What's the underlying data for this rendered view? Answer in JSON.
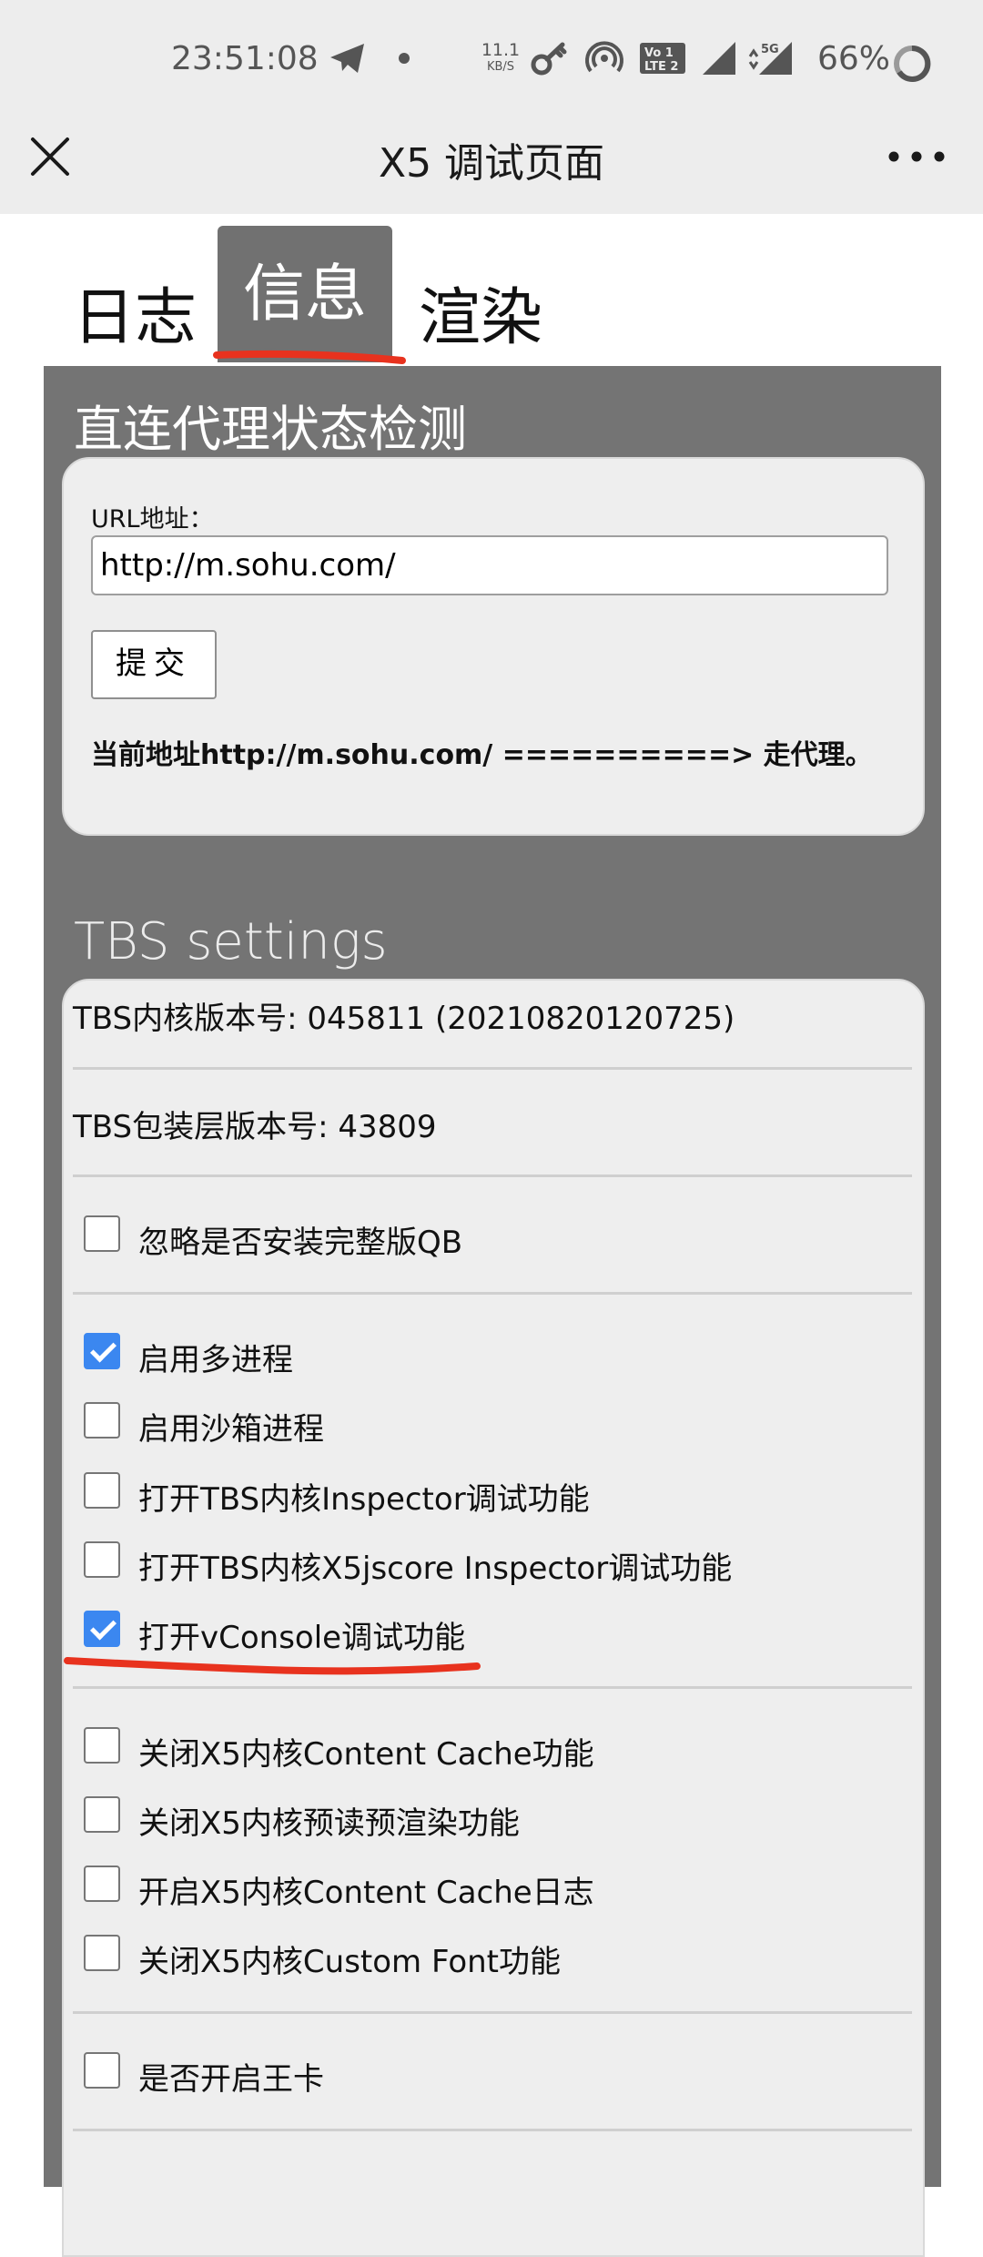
{
  "status_bar": {
    "time": "23:51:08",
    "net_speed_value": "11.1",
    "net_speed_unit": "KB/S",
    "battery": "66%",
    "icons": [
      "telegram-icon",
      "dot-icon",
      "key-icon",
      "hotspot-icon",
      "volte-icon",
      "signal-icon",
      "5g-signal-icon",
      "battery-icon"
    ]
  },
  "title_bar": {
    "title": "X5 调试页面",
    "close_icon": "close-icon",
    "more_icon": "more-icon"
  },
  "tabs": [
    {
      "label": "日志",
      "active": false
    },
    {
      "label": "信息",
      "active": true
    },
    {
      "label": "渲染",
      "active": false
    }
  ],
  "proxy_section": {
    "title": "直连代理状态检测",
    "url_label": "URL地址：",
    "url_value": "http://m.sohu.com/",
    "submit_label": "提交",
    "result": "当前地址http://m.sohu.com/ ==========> 走代理。"
  },
  "tbs_section": {
    "title": "TBS settings",
    "core_version": "TBS内核版本号: 045811 (20210820120725)",
    "wrapper_version": "TBS包装层版本号: 43809",
    "groups": [
      [
        {
          "label": "忽略是否安装完整版QB",
          "checked": false
        }
      ],
      [
        {
          "label": "启用多进程",
          "checked": true
        },
        {
          "label": "启用沙箱进程",
          "checked": false
        },
        {
          "label": "打开TBS内核Inspector调试功能",
          "checked": false
        },
        {
          "label": "打开TBS内核X5jscore Inspector调试功能",
          "checked": false
        },
        {
          "label": "打开vConsole调试功能",
          "checked": true
        }
      ],
      [
        {
          "label": "关闭X5内核Content Cache功能",
          "checked": false
        },
        {
          "label": "关闭X5内核预读预渲染功能",
          "checked": false
        },
        {
          "label": "开启X5内核Content Cache日志",
          "checked": false
        },
        {
          "label": "关闭X5内核Custom Font功能",
          "checked": false
        }
      ],
      [
        {
          "label": "是否开启王卡",
          "checked": false
        }
      ]
    ]
  },
  "colors": {
    "accent": "#3b87f0",
    "panel": "#747474",
    "active_tab": "#717171",
    "annotation": "#e8321e"
  }
}
